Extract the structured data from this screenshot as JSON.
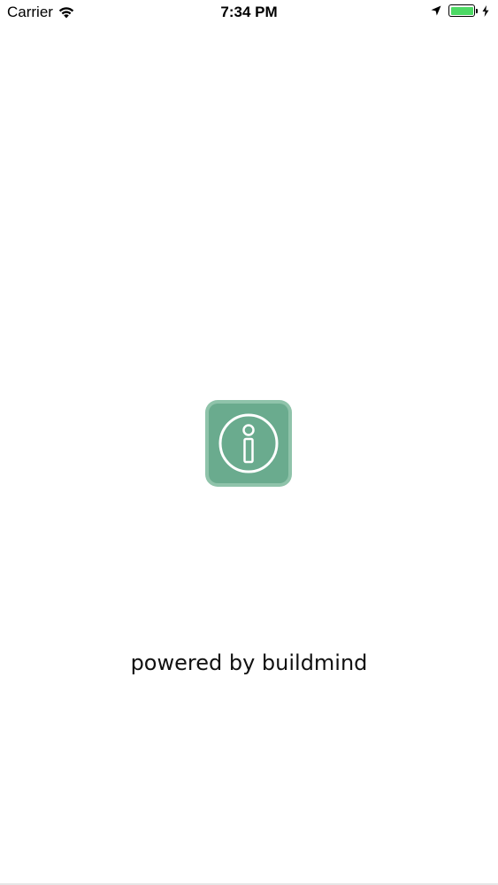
{
  "status_bar": {
    "carrier": "Carrier",
    "time": "7:34 PM",
    "battery_color": "#4cd964",
    "icons": [
      "wifi-icon",
      "location-arrow-icon",
      "battery-icon",
      "charging-bolt-icon"
    ]
  },
  "splash": {
    "app_icon": "info-icon",
    "icon_color": "#6aab8e",
    "icon_border_color": "#8fc3aa",
    "powered_by": "powered by buildmind"
  }
}
